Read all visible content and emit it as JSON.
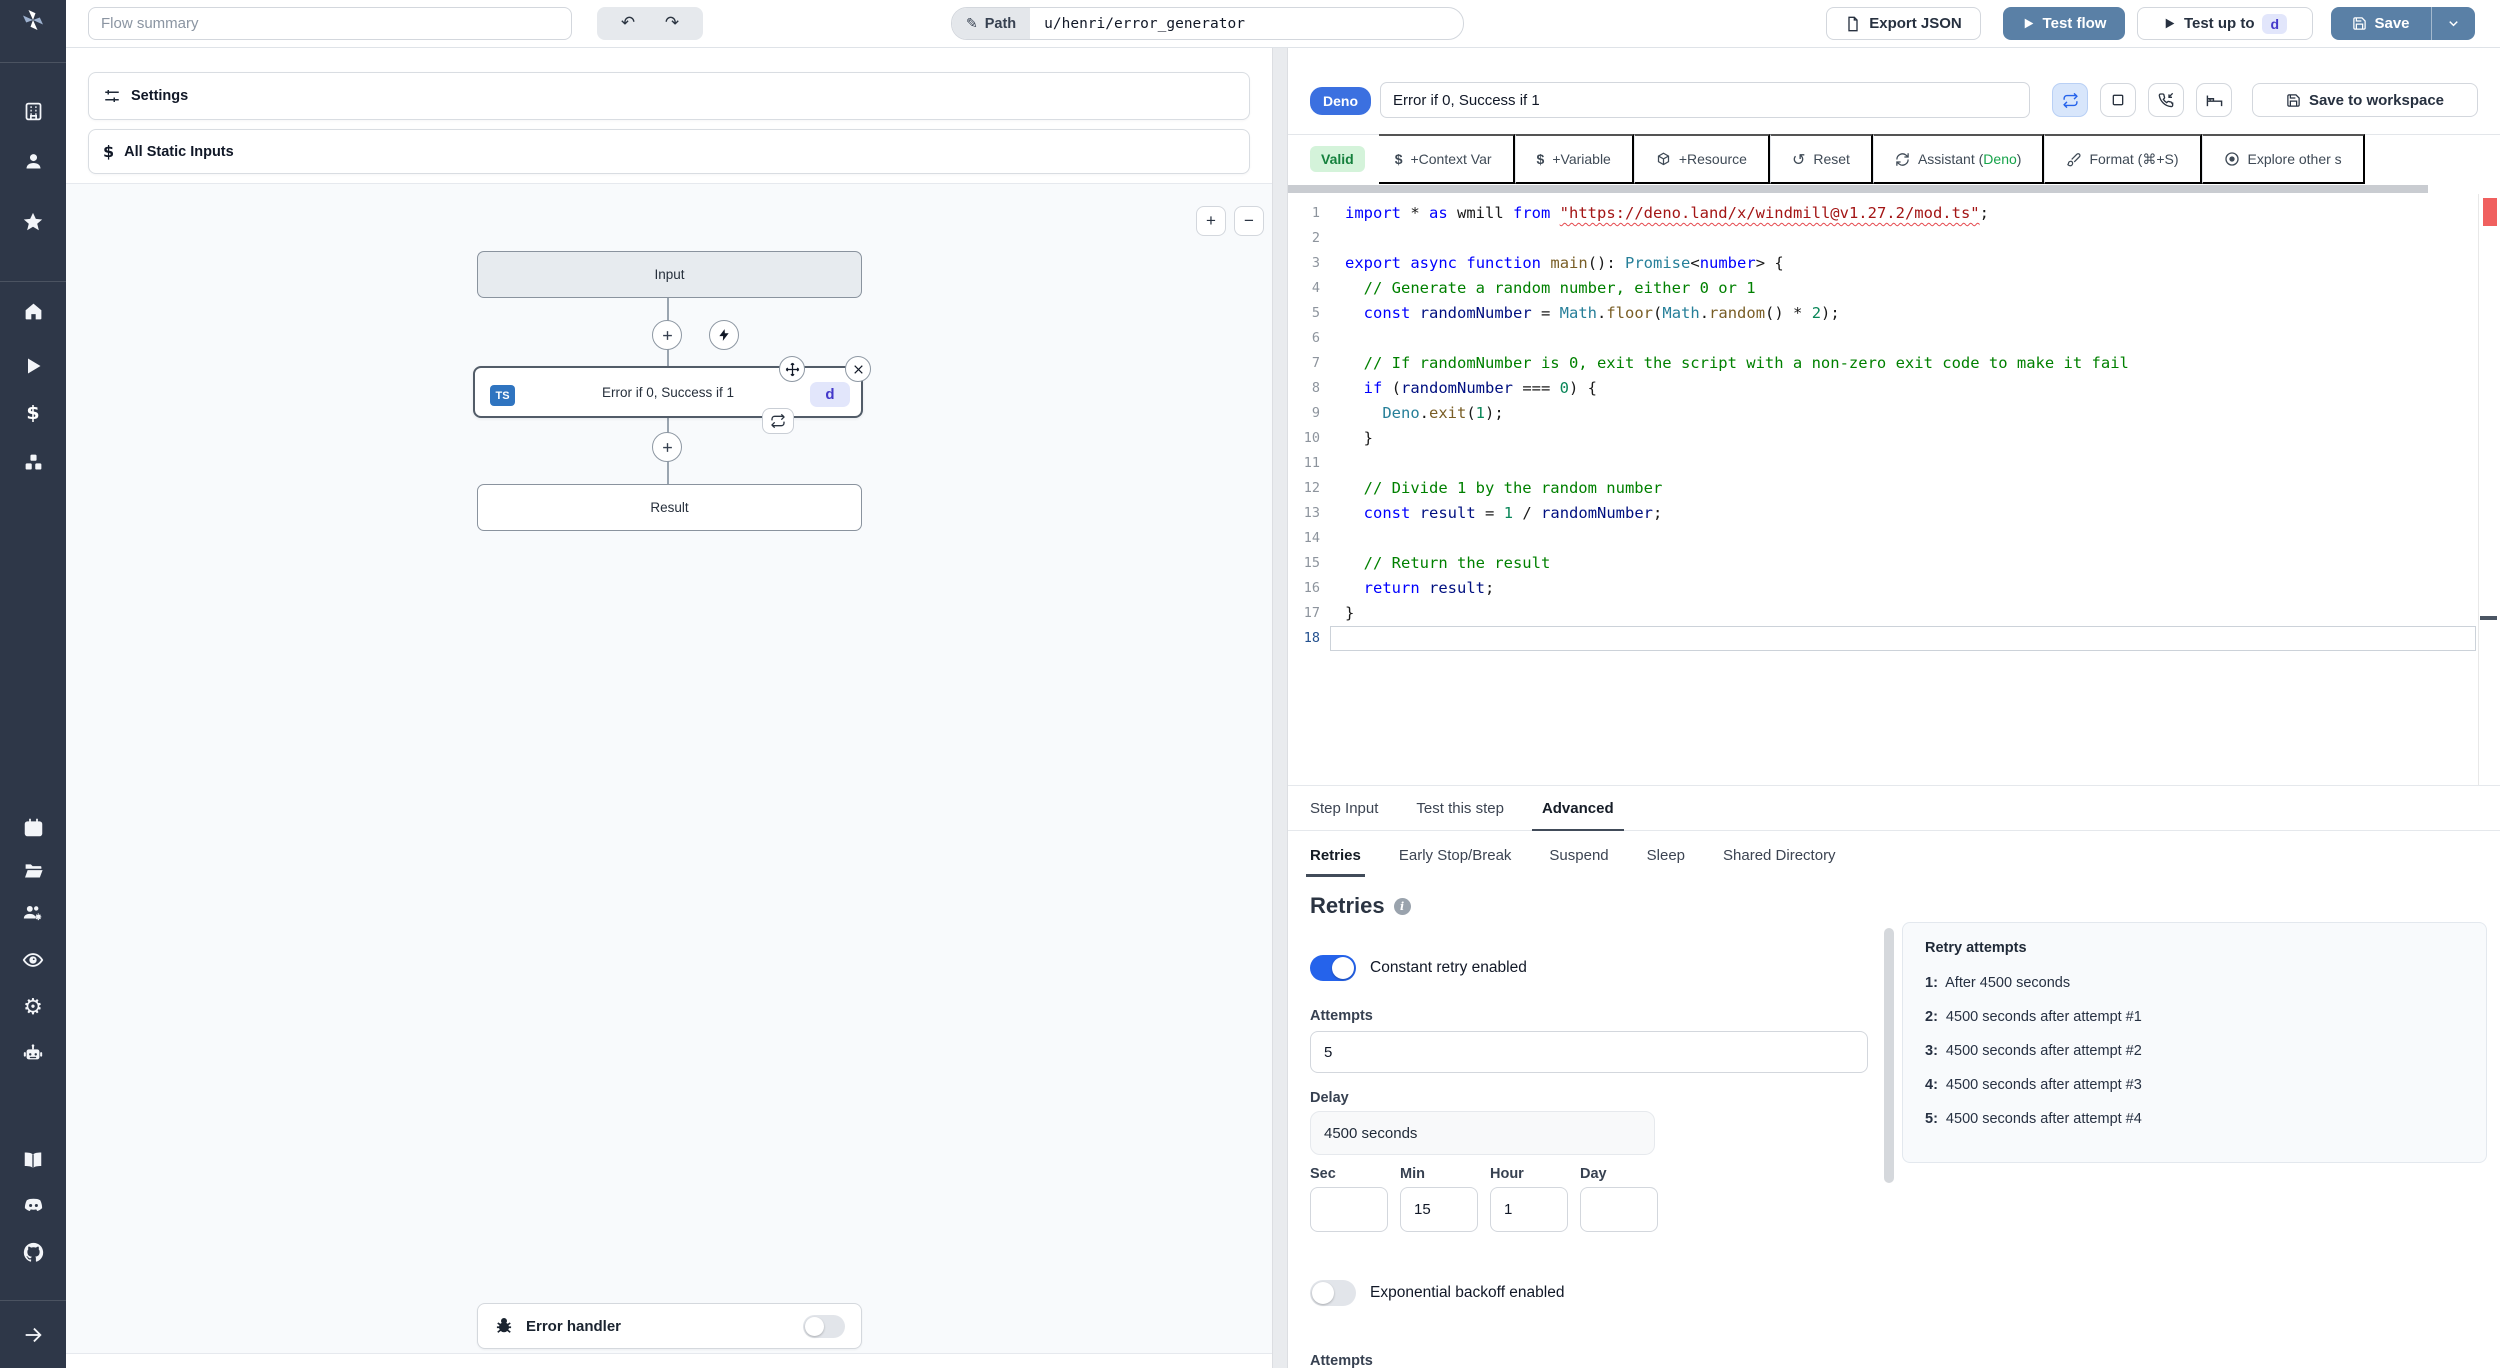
{
  "colors": {
    "rail_bg": "#2e3748",
    "primary_button": "#5a80a6",
    "deno_badge": "#3b70e0",
    "valid_green_bg": "#d4f3da",
    "valid_green_text": "#15803d",
    "toggle_on_blue": "#2563eb",
    "ts_badge_blue": "#2f74c0",
    "d_badge_bg": "#e2e6fb",
    "d_badge_text": "#4338ca",
    "error_marker_red": "#f0605f"
  },
  "topbar": {
    "flow_summary_placeholder": "Flow summary",
    "path_label": "Path",
    "path_value": "u/henri/error_generator",
    "export_json": "Export JSON",
    "test_flow": "Test flow",
    "test_up_to": "Test up to",
    "test_up_to_badge": "d",
    "save": "Save"
  },
  "sidebar": {
    "icons": [
      "windmill-logo",
      "building",
      "user",
      "star",
      "home",
      "play",
      "dollar",
      "boxes",
      "calendar",
      "folder-open",
      "users-gear",
      "eye",
      "gear",
      "robot",
      "book",
      "discord",
      "github",
      "arrow-right"
    ]
  },
  "flow": {
    "settings": "Settings",
    "all_static_inputs": "All Static Inputs",
    "zoom_in": "+",
    "zoom_out": "−",
    "nodes": {
      "input": "Input",
      "step_title": "Error if 0, Success if 1",
      "step_lang_badge": "TS",
      "step_suffix_badge": "d",
      "result": "Result"
    },
    "error_handler": "Error handler"
  },
  "editor": {
    "lang_badge": "Deno",
    "step_name": "Error if 0, Success if 1",
    "save_to_workspace": "Save to workspace",
    "toolbar": {
      "valid": "Valid",
      "context_var": "+Context Var",
      "variable": "+Variable",
      "resource": "+Resource",
      "reset": "Reset",
      "assistant_prefix": "Assistant (",
      "assistant_lang": "Deno",
      "assistant_suffix": ")",
      "format": "Format (⌘+S)",
      "explore": "Explore other s"
    },
    "code_lines": [
      {
        "n": 1,
        "t": [
          [
            "kw",
            "import"
          ],
          [
            "pl",
            " * "
          ],
          [
            "kw",
            "as"
          ],
          [
            "pl",
            " wmill "
          ],
          [
            "kw",
            "from"
          ],
          [
            "pl",
            " "
          ],
          [
            "sq",
            "\"https://deno.land/x/windmill@v1.27.2/mod.ts\""
          ],
          [
            "pl",
            ";"
          ]
        ]
      },
      {
        "n": 2,
        "t": []
      },
      {
        "n": 3,
        "t": [
          [
            "kw",
            "export"
          ],
          [
            "pl",
            " "
          ],
          [
            "kw",
            "async"
          ],
          [
            "pl",
            " "
          ],
          [
            "kw",
            "function"
          ],
          [
            "pl",
            " "
          ],
          [
            "fn",
            "main"
          ],
          [
            "pl",
            "(): "
          ],
          [
            "ty",
            "Promise"
          ],
          [
            "pl",
            "<"
          ],
          [
            "kw",
            "number"
          ],
          [
            "pl",
            "> {"
          ]
        ]
      },
      {
        "n": 4,
        "t": [
          [
            "cm",
            "  // Generate a random number, either 0 or 1"
          ]
        ]
      },
      {
        "n": 5,
        "t": [
          [
            "pl",
            "  "
          ],
          [
            "kw",
            "const"
          ],
          [
            "pl",
            " "
          ],
          [
            "vr",
            "randomNumber"
          ],
          [
            "pl",
            " = "
          ],
          [
            "ty",
            "Math"
          ],
          [
            "pl",
            "."
          ],
          [
            "fn",
            "floor"
          ],
          [
            "pl",
            "("
          ],
          [
            "ty",
            "Math"
          ],
          [
            "pl",
            "."
          ],
          [
            "fn",
            "random"
          ],
          [
            "pl",
            "() * "
          ],
          [
            "nu",
            "2"
          ],
          [
            "pl",
            ");"
          ]
        ]
      },
      {
        "n": 6,
        "t": []
      },
      {
        "n": 7,
        "t": [
          [
            "cm",
            "  // If randomNumber is 0, exit the script with a non-zero exit code to make it fail"
          ]
        ]
      },
      {
        "n": 8,
        "t": [
          [
            "pl",
            "  "
          ],
          [
            "kw",
            "if"
          ],
          [
            "pl",
            " ("
          ],
          [
            "vr",
            "randomNumber"
          ],
          [
            "pl",
            " === "
          ],
          [
            "nu",
            "0"
          ],
          [
            "pl",
            ") {"
          ]
        ]
      },
      {
        "n": 9,
        "t": [
          [
            "pl",
            "    "
          ],
          [
            "ty",
            "Deno"
          ],
          [
            "pl",
            "."
          ],
          [
            "fn",
            "exit"
          ],
          [
            "pl",
            "("
          ],
          [
            "nu",
            "1"
          ],
          [
            "pl",
            ");"
          ]
        ]
      },
      {
        "n": 10,
        "t": [
          [
            "pl",
            "  }"
          ]
        ]
      },
      {
        "n": 11,
        "t": []
      },
      {
        "n": 12,
        "t": [
          [
            "cm",
            "  // Divide 1 by the random number"
          ]
        ]
      },
      {
        "n": 13,
        "t": [
          [
            "pl",
            "  "
          ],
          [
            "kw",
            "const"
          ],
          [
            "pl",
            " "
          ],
          [
            "vr",
            "result"
          ],
          [
            "pl",
            " = "
          ],
          [
            "nu",
            "1"
          ],
          [
            "pl",
            " / "
          ],
          [
            "vr",
            "randomNumber"
          ],
          [
            "pl",
            ";"
          ]
        ]
      },
      {
        "n": 14,
        "t": []
      },
      {
        "n": 15,
        "t": [
          [
            "cm",
            "  // Return the result"
          ]
        ]
      },
      {
        "n": 16,
        "t": [
          [
            "pl",
            "  "
          ],
          [
            "kw",
            "return"
          ],
          [
            "pl",
            " "
          ],
          [
            "vr",
            "result"
          ],
          [
            "pl",
            ";"
          ]
        ]
      },
      {
        "n": 17,
        "t": [
          [
            "pl",
            "}"
          ]
        ]
      },
      {
        "n": 18,
        "t": [],
        "active": true
      }
    ]
  },
  "tabs": {
    "main": [
      {
        "label": "Step Input",
        "active": false
      },
      {
        "label": "Test this step",
        "active": false
      },
      {
        "label": "Advanced",
        "active": true
      }
    ],
    "advanced": [
      {
        "label": "Retries",
        "active": true
      },
      {
        "label": "Early Stop/Break",
        "active": false
      },
      {
        "label": "Suspend",
        "active": false
      },
      {
        "label": "Sleep",
        "active": false
      },
      {
        "label": "Shared Directory",
        "active": false
      }
    ]
  },
  "retries": {
    "title": "Retries",
    "constant_label": "Constant retry enabled",
    "attempts_label": "Attempts",
    "attempts_value": "5",
    "delay_label": "Delay",
    "delay_value": "4500 seconds",
    "units": [
      {
        "label": "Sec",
        "value": ""
      },
      {
        "label": "Min",
        "value": "15"
      },
      {
        "label": "Hour",
        "value": "1"
      },
      {
        "label": "Day",
        "value": ""
      }
    ],
    "exponential_label": "Exponential backoff enabled",
    "exponential_attempts_label": "Attempts",
    "attempts_panel": {
      "title": "Retry attempts",
      "items": [
        {
          "n": "1:",
          "text": "After 4500 seconds"
        },
        {
          "n": "2:",
          "text": "4500 seconds after attempt #1"
        },
        {
          "n": "3:",
          "text": "4500 seconds after attempt #2"
        },
        {
          "n": "4:",
          "text": "4500 seconds after attempt #3"
        },
        {
          "n": "5:",
          "text": "4500 seconds after attempt #4"
        }
      ]
    }
  }
}
